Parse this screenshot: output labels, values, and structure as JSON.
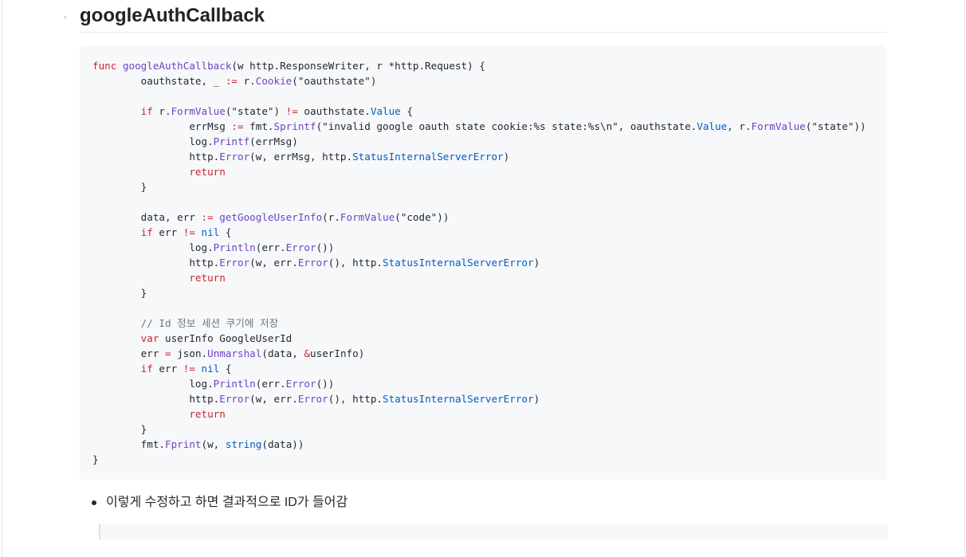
{
  "heading": "googleAuthCallback",
  "code": {
    "lines": [
      [
        [
          "kw",
          "func"
        ],
        [
          "t",
          " "
        ],
        [
          "fn",
          "googleAuthCallback"
        ],
        [
          "t",
          "(w http.ResponseWriter, r *http.Request) {"
        ]
      ],
      [
        [
          "t",
          "\toauthstate, _ "
        ],
        [
          "kw",
          ":="
        ],
        [
          "t",
          " r."
        ],
        [
          "mt",
          "Cookie"
        ],
        [
          "t",
          "(\"oauthstate\")"
        ]
      ],
      [],
      [
        [
          "t",
          "\t"
        ],
        [
          "kw",
          "if"
        ],
        [
          "t",
          " r."
        ],
        [
          "mt",
          "FormValue"
        ],
        [
          "t",
          "(\"state\") "
        ],
        [
          "kw",
          "!="
        ],
        [
          "t",
          " oauthstate."
        ],
        [
          "bi",
          "Value"
        ],
        [
          "t",
          " {"
        ]
      ],
      [
        [
          "t",
          "\t\terrMsg "
        ],
        [
          "kw",
          ":="
        ],
        [
          "t",
          " fmt."
        ],
        [
          "mt",
          "Sprintf"
        ],
        [
          "t",
          "(\"invalid google oauth state cookie:%s state:%s\\n\", oauthstate."
        ],
        [
          "bi",
          "Value"
        ],
        [
          "t",
          ", r."
        ],
        [
          "mt",
          "FormValue"
        ],
        [
          "t",
          "(\"state\"))"
        ]
      ],
      [
        [
          "t",
          "\t\tlog."
        ],
        [
          "mt",
          "Printf"
        ],
        [
          "t",
          "(errMsg)"
        ]
      ],
      [
        [
          "t",
          "\t\thttp."
        ],
        [
          "mt",
          "Error"
        ],
        [
          "t",
          "(w, errMsg, http."
        ],
        [
          "bi",
          "StatusInternalServerError"
        ],
        [
          "t",
          ")"
        ]
      ],
      [
        [
          "t",
          "\t\t"
        ],
        [
          "kw",
          "return"
        ]
      ],
      [
        [
          "t",
          "\t}"
        ]
      ],
      [],
      [
        [
          "t",
          "\tdata, err "
        ],
        [
          "kw",
          ":="
        ],
        [
          "t",
          " "
        ],
        [
          "fn",
          "getGoogleUserInfo"
        ],
        [
          "t",
          "(r."
        ],
        [
          "mt",
          "FormValue"
        ],
        [
          "t",
          "(\"code\"))"
        ]
      ],
      [
        [
          "t",
          "\t"
        ],
        [
          "kw",
          "if"
        ],
        [
          "t",
          " err "
        ],
        [
          "kw",
          "!="
        ],
        [
          "t",
          " "
        ],
        [
          "bi",
          "nil"
        ],
        [
          "t",
          " {"
        ]
      ],
      [
        [
          "t",
          "\t\tlog."
        ],
        [
          "mt",
          "Println"
        ],
        [
          "t",
          "(err."
        ],
        [
          "mt",
          "Error"
        ],
        [
          "t",
          "())"
        ]
      ],
      [
        [
          "t",
          "\t\thttp."
        ],
        [
          "mt",
          "Error"
        ],
        [
          "t",
          "(w, err."
        ],
        [
          "mt",
          "Error"
        ],
        [
          "t",
          "(), http."
        ],
        [
          "bi",
          "StatusInternalServerError"
        ],
        [
          "t",
          ")"
        ]
      ],
      [
        [
          "t",
          "\t\t"
        ],
        [
          "kw",
          "return"
        ]
      ],
      [
        [
          "t",
          "\t}"
        ]
      ],
      [],
      [
        [
          "t",
          "\t"
        ],
        [
          "cm",
          "// Id 정보 세션 쿠기에 저장"
        ]
      ],
      [
        [
          "t",
          "\t"
        ],
        [
          "kw",
          "var"
        ],
        [
          "t",
          " userInfo GoogleUserId"
        ]
      ],
      [
        [
          "t",
          "\terr "
        ],
        [
          "kw",
          "="
        ],
        [
          "t",
          " json."
        ],
        [
          "mt",
          "Unmarshal"
        ],
        [
          "t",
          "(data, "
        ],
        [
          "kw",
          "&"
        ],
        [
          "t",
          "userInfo)"
        ]
      ],
      [
        [
          "t",
          "\t"
        ],
        [
          "kw",
          "if"
        ],
        [
          "t",
          " err "
        ],
        [
          "kw",
          "!="
        ],
        [
          "t",
          " "
        ],
        [
          "bi",
          "nil"
        ],
        [
          "t",
          " {"
        ]
      ],
      [
        [
          "t",
          "\t\tlog."
        ],
        [
          "mt",
          "Println"
        ],
        [
          "t",
          "(err."
        ],
        [
          "mt",
          "Error"
        ],
        [
          "t",
          "())"
        ]
      ],
      [
        [
          "t",
          "\t\thttp."
        ],
        [
          "mt",
          "Error"
        ],
        [
          "t",
          "(w, err."
        ],
        [
          "mt",
          "Error"
        ],
        [
          "t",
          "(), http."
        ],
        [
          "bi",
          "StatusInternalServerError"
        ],
        [
          "t",
          ")"
        ]
      ],
      [
        [
          "t",
          "\t\t"
        ],
        [
          "kw",
          "return"
        ]
      ],
      [
        [
          "t",
          "\t}"
        ]
      ],
      [
        [
          "t",
          "\tfmt."
        ],
        [
          "mt",
          "Fprint"
        ],
        [
          "t",
          "(w, "
        ],
        [
          "bi",
          "string"
        ],
        [
          "t",
          "(data))"
        ]
      ],
      [
        [
          "t",
          "}"
        ]
      ]
    ]
  },
  "bullets": [
    "이렇게 수정하고 하면 결과적으로 ID가 들어감"
  ]
}
